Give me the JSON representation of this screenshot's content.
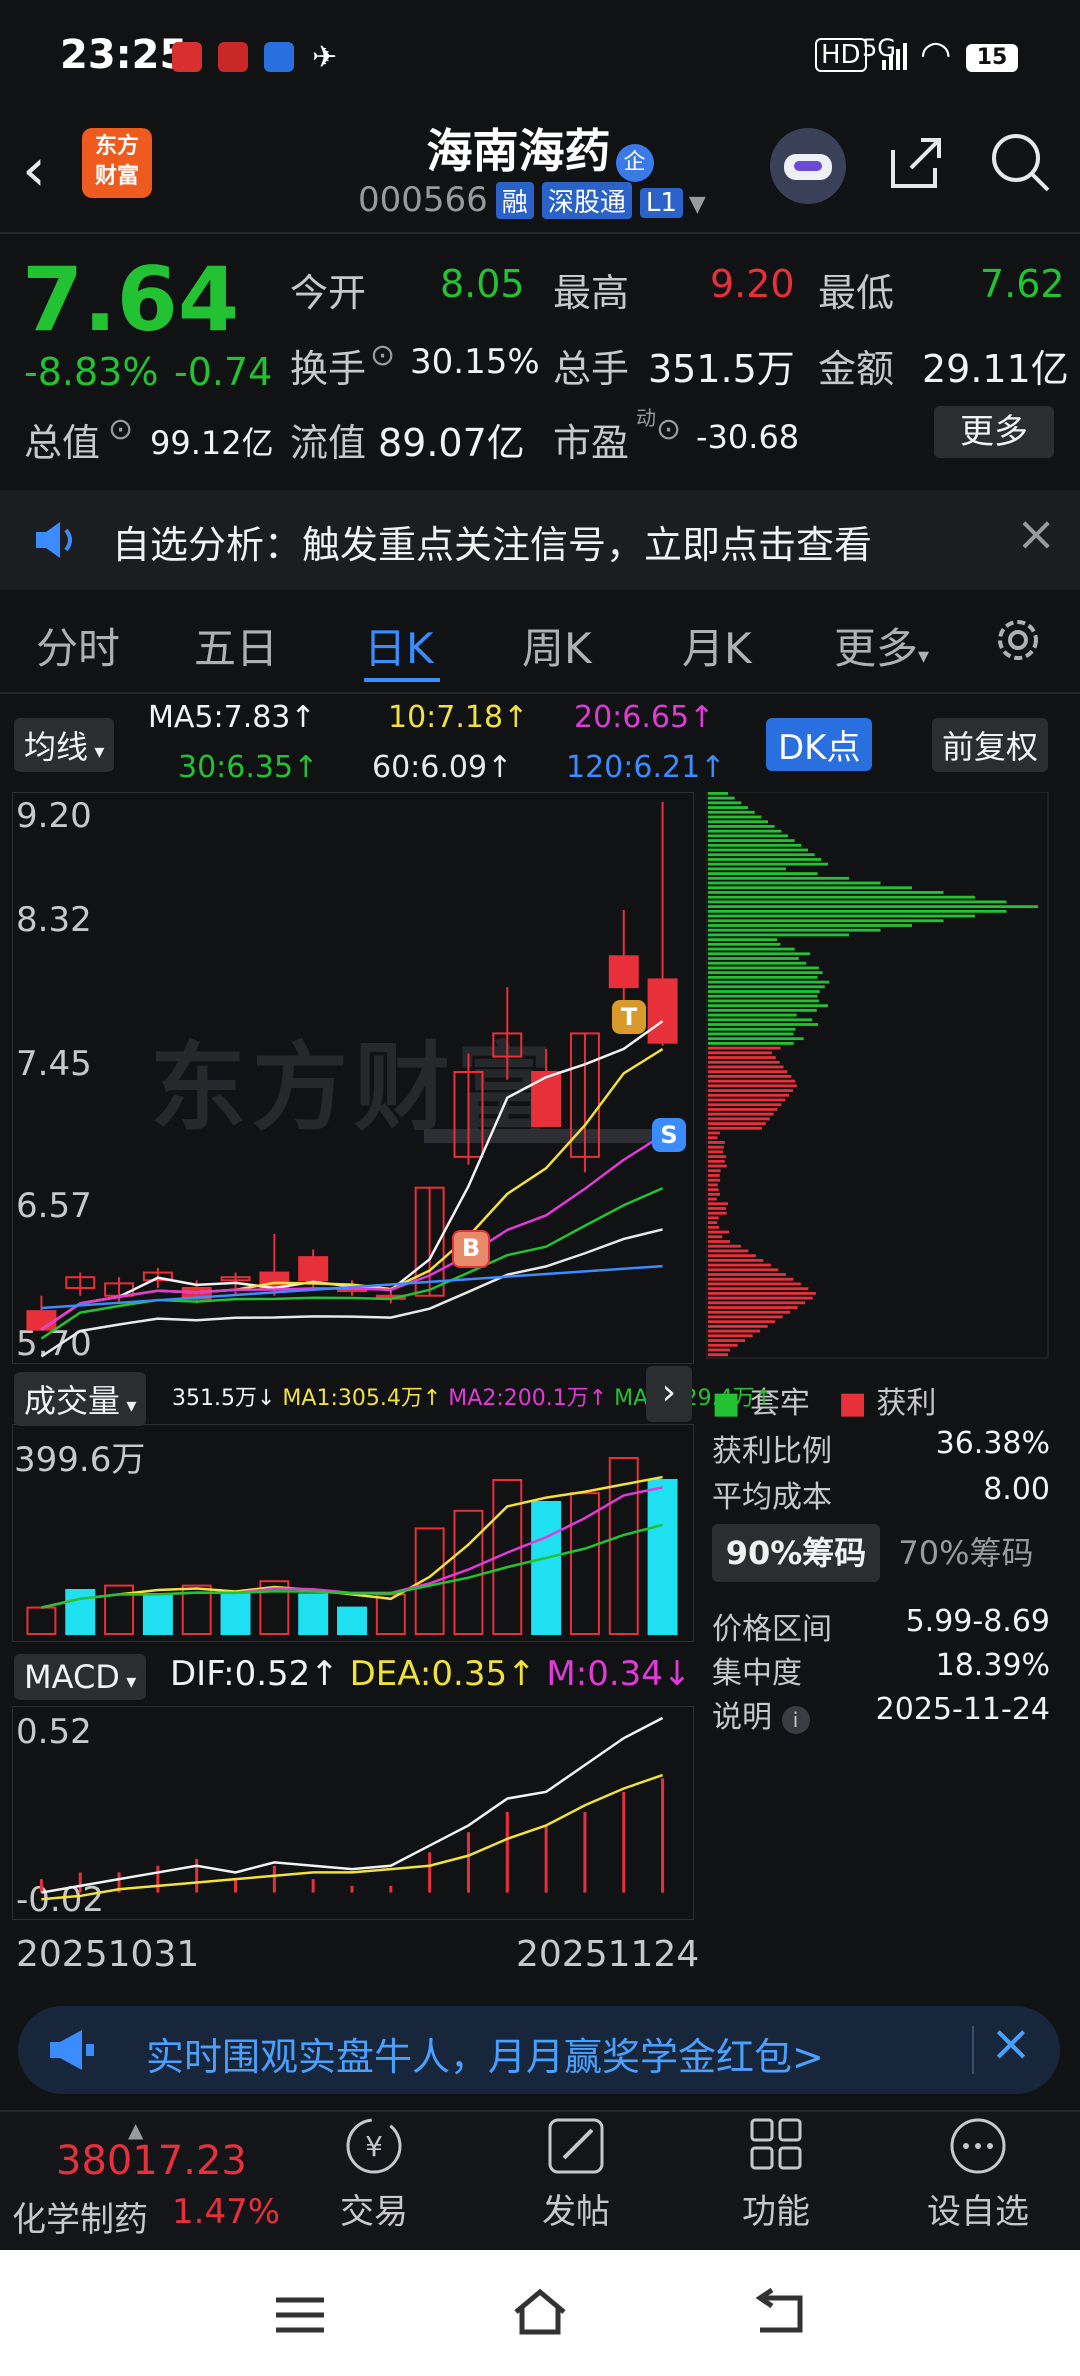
{
  "status_bar": {
    "time": "23:25",
    "battery": "15",
    "network": "5G"
  },
  "header": {
    "brand": "东方\n财富",
    "title": "海南海药",
    "title_badge": "企",
    "code": "000566",
    "tags": [
      "融",
      "深股通",
      "L1"
    ]
  },
  "quote": {
    "price": "7.64",
    "change_pct": "-8.83%",
    "change_abs": "-0.74",
    "open_label": "今开",
    "open": "8.05",
    "high_label": "最高",
    "high": "9.20",
    "low_label": "最低",
    "low": "7.62",
    "turnover_label": "换手",
    "turnover": "30.15%",
    "volume_label": "总手",
    "volume": "351.5万",
    "amount_label": "金额",
    "amount": "29.11亿",
    "mktcap_label": "总值",
    "mktcap": "99.12亿",
    "float_label": "流值",
    "float_cap": "89.07亿",
    "pe_label": "市盈",
    "pe_sup": "动",
    "pe": "-30.68",
    "more_button": "更多"
  },
  "banner": {
    "text": "自选分析：触发重点关注信号，立即点击查看"
  },
  "tabs": [
    "分时",
    "五日",
    "日K",
    "周K",
    "月K",
    "更多"
  ],
  "active_tab": "日K",
  "ma_legend": {
    "selector": "均线",
    "items": [
      {
        "text": "MA5:7.83",
        "arrow": "↑",
        "color": "#f2f2f2"
      },
      {
        "text": "10:7.18",
        "arrow": "↑",
        "color": "#f0e23a"
      },
      {
        "text": "20:6.65",
        "arrow": "↑",
        "color": "#e23ad8"
      },
      {
        "text": "30:6.35",
        "arrow": "↑",
        "color": "#22c232"
      },
      {
        "text": "60:6.09",
        "arrow": "↑",
        "color": "#e8e8e8"
      },
      {
        "text": "120:6.21",
        "arrow": "↑",
        "color": "#3a8cff"
      }
    ],
    "dk_button": "DK点",
    "adjust_button": "前复权"
  },
  "price_axis": [
    "9.20",
    "8.32",
    "7.45",
    "6.57",
    "5.70"
  ],
  "watermark": "东方财富",
  "markers": {
    "buy": "B",
    "top": "T",
    "sell": "S"
  },
  "chip_panel": {
    "legend_trapped": "套牢",
    "legend_profit": "获利",
    "profit_ratio_label": "获利比例",
    "profit_ratio": "36.38%",
    "avg_cost_label": "平均成本",
    "avg_cost": "8.00",
    "tab_90": "90%筹码",
    "tab_70": "70%筹码",
    "range_label": "价格区间",
    "range": "5.99-8.69",
    "concentration_label": "集中度",
    "concentration": "18.39%",
    "note_label": "说明",
    "note_date": "2025-11-24"
  },
  "volume_panel": {
    "selector": "成交量",
    "legend": [
      {
        "text": "351.5万",
        "arrow": "↓",
        "color": "#f2f2f2"
      },
      {
        "text": "MA1:305.4万",
        "arrow": "↑",
        "color": "#f0e23a"
      },
      {
        "text": "MA2:200.1万",
        "arrow": "↑",
        "color": "#e23ad8"
      },
      {
        "text": "MA3:129.4万",
        "arrow": "↑",
        "color": "#22c232"
      }
    ],
    "axis_max": "399.6万"
  },
  "macd_panel": {
    "selector": "MACD",
    "legend": [
      {
        "text": "DIF:0.52",
        "arrow": "↑",
        "color": "#f2f2f2"
      },
      {
        "text": "DEA:0.35",
        "arrow": "↑",
        "color": "#f0e23a"
      },
      {
        "text": "M:0.34",
        "arrow": "↓",
        "color": "#e23ad8"
      }
    ],
    "axis_top": "0.52",
    "axis_bottom": "-0.02"
  },
  "date_axis": {
    "start": "20251031",
    "end": "20251124"
  },
  "promo": {
    "text": "实时围观实盘牛人，月月赢奖学金红包>"
  },
  "bottom_nav": {
    "index_value": "38017.23",
    "index_name": "化学制药",
    "index_change": "1.47%",
    "items": [
      "交易",
      "发帖",
      "功能",
      "设自选"
    ]
  },
  "colors": {
    "up": "#e8303a",
    "down": "#22c232",
    "accent": "#3a8cff",
    "background": "#111214"
  },
  "chart_data": {
    "type": "candlestick",
    "candles": [
      {
        "o": 5.9,
        "h": 6.0,
        "l": 5.8,
        "c": 5.78
      },
      {
        "o": 6.05,
        "h": 6.15,
        "l": 6.0,
        "c": 6.12
      },
      {
        "o": 6.0,
        "h": 6.12,
        "l": 5.95,
        "c": 6.08
      },
      {
        "o": 6.1,
        "h": 6.18,
        "l": 6.05,
        "c": 6.15
      },
      {
        "o": 6.05,
        "h": 6.1,
        "l": 5.95,
        "c": 5.98
      },
      {
        "o": 6.1,
        "h": 6.15,
        "l": 6.0,
        "c": 6.12
      },
      {
        "o": 6.15,
        "h": 6.4,
        "l": 6.0,
        "c": 6.05
      },
      {
        "o": 6.25,
        "h": 6.3,
        "l": 6.05,
        "c": 6.1
      },
      {
        "o": 6.05,
        "h": 6.1,
        "l": 6.0,
        "c": 6.03
      },
      {
        "o": 6.0,
        "h": 6.05,
        "l": 5.95,
        "c": 5.98
      },
      {
        "o": 6.0,
        "h": 6.7,
        "l": 6.0,
        "c": 6.7
      },
      {
        "o": 6.9,
        "h": 7.57,
        "l": 6.85,
        "c": 7.45
      },
      {
        "o": 7.55,
        "h": 8.0,
        "l": 7.4,
        "c": 7.7
      },
      {
        "o": 7.45,
        "h": 7.6,
        "l": 7.1,
        "c": 7.1
      },
      {
        "o": 6.9,
        "h": 7.7,
        "l": 6.8,
        "c": 7.7
      },
      {
        "o": 8.2,
        "h": 8.5,
        "l": 7.8,
        "c": 8.0
      },
      {
        "o": 8.05,
        "h": 9.2,
        "l": 7.62,
        "c": 7.64
      }
    ],
    "ylim": [
      5.7,
      9.2
    ],
    "volume": [
      0.6,
      1.0,
      1.1,
      0.9,
      1.1,
      0.9,
      1.2,
      0.9,
      0.6,
      0.9,
      2.4,
      2.8,
      3.5,
      3.0,
      3.2,
      4.0,
      3.5
    ],
    "volume_up": [
      true,
      false,
      true,
      false,
      true,
      false,
      true,
      false,
      false,
      true,
      true,
      true,
      true,
      false,
      true,
      true,
      false
    ],
    "macd": [
      0.0,
      0.02,
      0.04,
      0.06,
      0.08,
      0.06,
      0.09,
      0.08,
      0.07,
      0.08,
      0.14,
      0.2,
      0.28,
      0.3,
      0.38,
      0.46,
      0.52
    ],
    "macd_dea": [
      -0.02,
      -0.01,
      0.01,
      0.02,
      0.03,
      0.04,
      0.05,
      0.06,
      0.06,
      0.07,
      0.08,
      0.11,
      0.16,
      0.2,
      0.26,
      0.31,
      0.35
    ]
  }
}
